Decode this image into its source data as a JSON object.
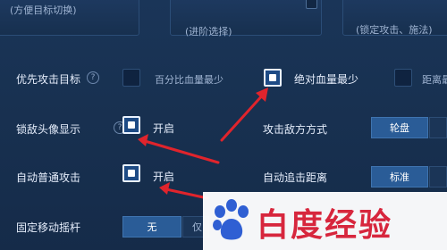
{
  "top_cards": [
    {
      "text": "(方便目标切换)"
    },
    {
      "text": "(进阶选择)"
    },
    {
      "text": "(锁定攻击、施法)"
    }
  ],
  "rows": {
    "priority_target": {
      "label": "优先攻击目标",
      "option1": "百分比血量最少",
      "option2": "绝对血量最少",
      "option3": "距离最"
    },
    "lock_avatar": {
      "label": "锁敌头像显示",
      "value": "开启"
    },
    "attack_mode": {
      "label": "攻击敌方方式",
      "option": "轮盘"
    },
    "auto_attack": {
      "label": "自动普通攻击",
      "value": "开启"
    },
    "auto_chase": {
      "label": "自动追击距离",
      "option": "标准"
    },
    "fixed_joystick": {
      "label": "固定移动摇杆",
      "option_active": "无",
      "option_next": "仅"
    }
  },
  "help_icon": "?",
  "watermark": {
    "text": "白度经验",
    "logo": "baidu-paw-logo"
  },
  "colors": {
    "arrow": "#e0242c",
    "active_seg": "#2a5c97",
    "watermark": "#d7263d"
  }
}
